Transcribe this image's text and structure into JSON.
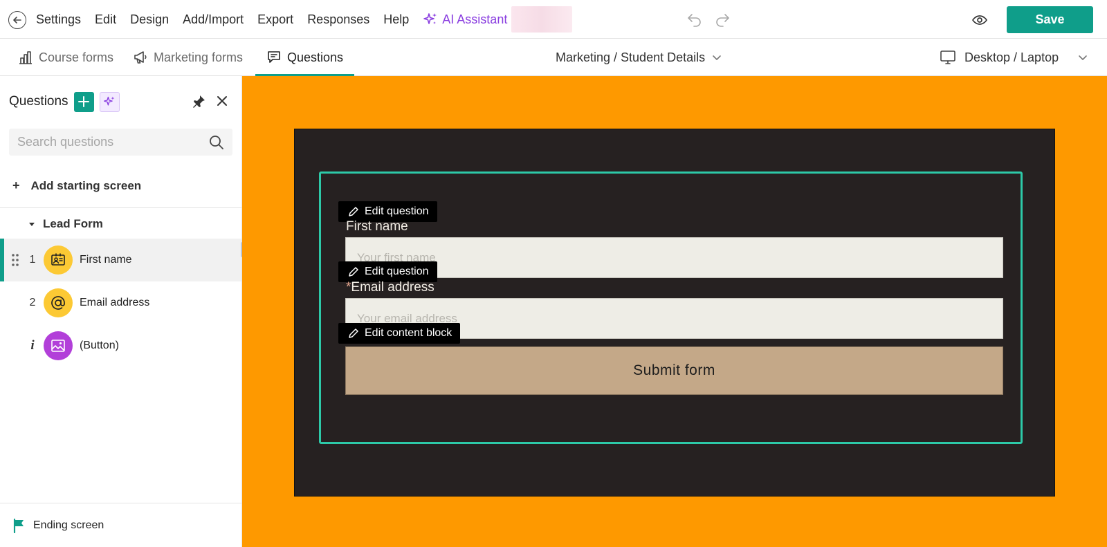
{
  "menu": {
    "items": [
      "Settings",
      "Edit",
      "Design",
      "Add/Import",
      "Export",
      "Responses",
      "Help"
    ],
    "ai_assistant": "AI Assistant",
    "save_label": "Save"
  },
  "toolbar": {
    "tabs": [
      {
        "label": "Course forms",
        "icon": "bar-chart-icon"
      },
      {
        "label": "Marketing forms",
        "icon": "megaphone-icon"
      },
      {
        "label": "Questions",
        "icon": "chat-questions-icon",
        "active": true
      }
    ],
    "breadcrumb": "Marketing / Student Details",
    "device": "Desktop / Laptop"
  },
  "sidebar": {
    "title": "Questions",
    "search_placeholder": "Search questions",
    "add_starting_screen": "Add starting screen",
    "section": "Lead Form",
    "questions": [
      {
        "num": "1",
        "label": "First name",
        "icon": "id-card-icon",
        "selected": true
      },
      {
        "num": "2",
        "label": "Email address",
        "icon": "at-sign-icon"
      },
      {
        "num": "i",
        "label": "(Button)",
        "icon": "image-icon"
      }
    ],
    "ending_screen": "Ending screen"
  },
  "form": {
    "edit_question_label": "Edit question",
    "edit_content_label": "Edit content block",
    "fields": [
      {
        "label": "First name",
        "placeholder": "Your first name",
        "required": false
      },
      {
        "label": "Email address",
        "placeholder": "Your email address",
        "required": true,
        "required_mark": "*"
      }
    ],
    "submit_label": "Submit form"
  },
  "colors": {
    "accent": "#0f9e8a",
    "canvas_bg": "#fe9900",
    "card_bg": "#262121",
    "selection": "#2dc9a8",
    "ai_purple": "#8a3ee0",
    "submit_bg": "#c4a888"
  }
}
